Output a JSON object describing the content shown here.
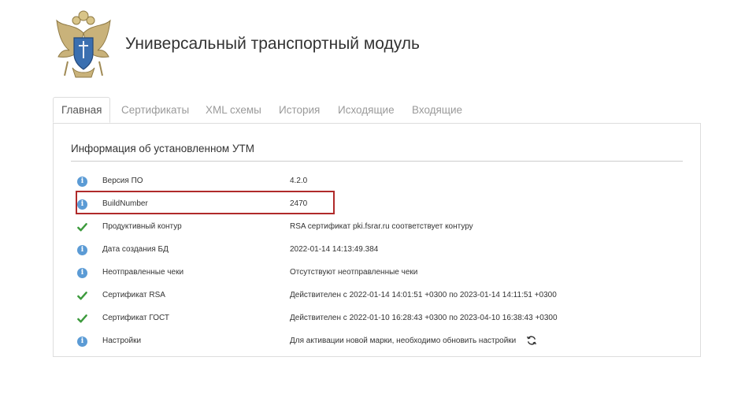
{
  "app": {
    "title": "Универсальный транспортный модуль"
  },
  "tabs": [
    {
      "label": "Главная",
      "active": true
    },
    {
      "label": "Сертификаты"
    },
    {
      "label": "XML схемы"
    },
    {
      "label": "История"
    },
    {
      "label": "Исходящие"
    },
    {
      "label": "Входящие"
    }
  ],
  "section": {
    "title": "Информация об установленном УТМ"
  },
  "rows": [
    {
      "icon": "info-icon",
      "label": "Версия ПО",
      "value": "4.2.0"
    },
    {
      "icon": "info-icon",
      "label": "BuildNumber",
      "value": "2470"
    },
    {
      "icon": "check-icon",
      "label": "Продуктивный контур",
      "value": "RSA сертификат pki.fsrar.ru соответствует контуру"
    },
    {
      "icon": "info-icon",
      "label": "Дата создания БД",
      "value": "2022-01-14 14:13:49.384"
    },
    {
      "icon": "info-icon",
      "label": "Неотправленные чеки",
      "value": "Отсутствуют неотправленные чеки"
    },
    {
      "icon": "check-icon",
      "label": "Сертификат RSA",
      "value": "Действителен с 2022-01-14 14:01:51 +0300 по 2023-01-14 14:11:51 +0300"
    },
    {
      "icon": "check-icon",
      "label": "Сертификат ГОСТ",
      "value": "Действителен с 2022-01-10 16:28:43 +0300 по 2023-04-10 16:38:43 +0300"
    },
    {
      "icon": "info-icon",
      "label": "Настройки",
      "value": "Для активации новой марки, необходимо обновить настройки",
      "action_icon": "refresh-icon"
    }
  ],
  "colors": {
    "info": "#5b9bd5",
    "check": "#3c9a3c",
    "highlight": "#b02a2a"
  }
}
